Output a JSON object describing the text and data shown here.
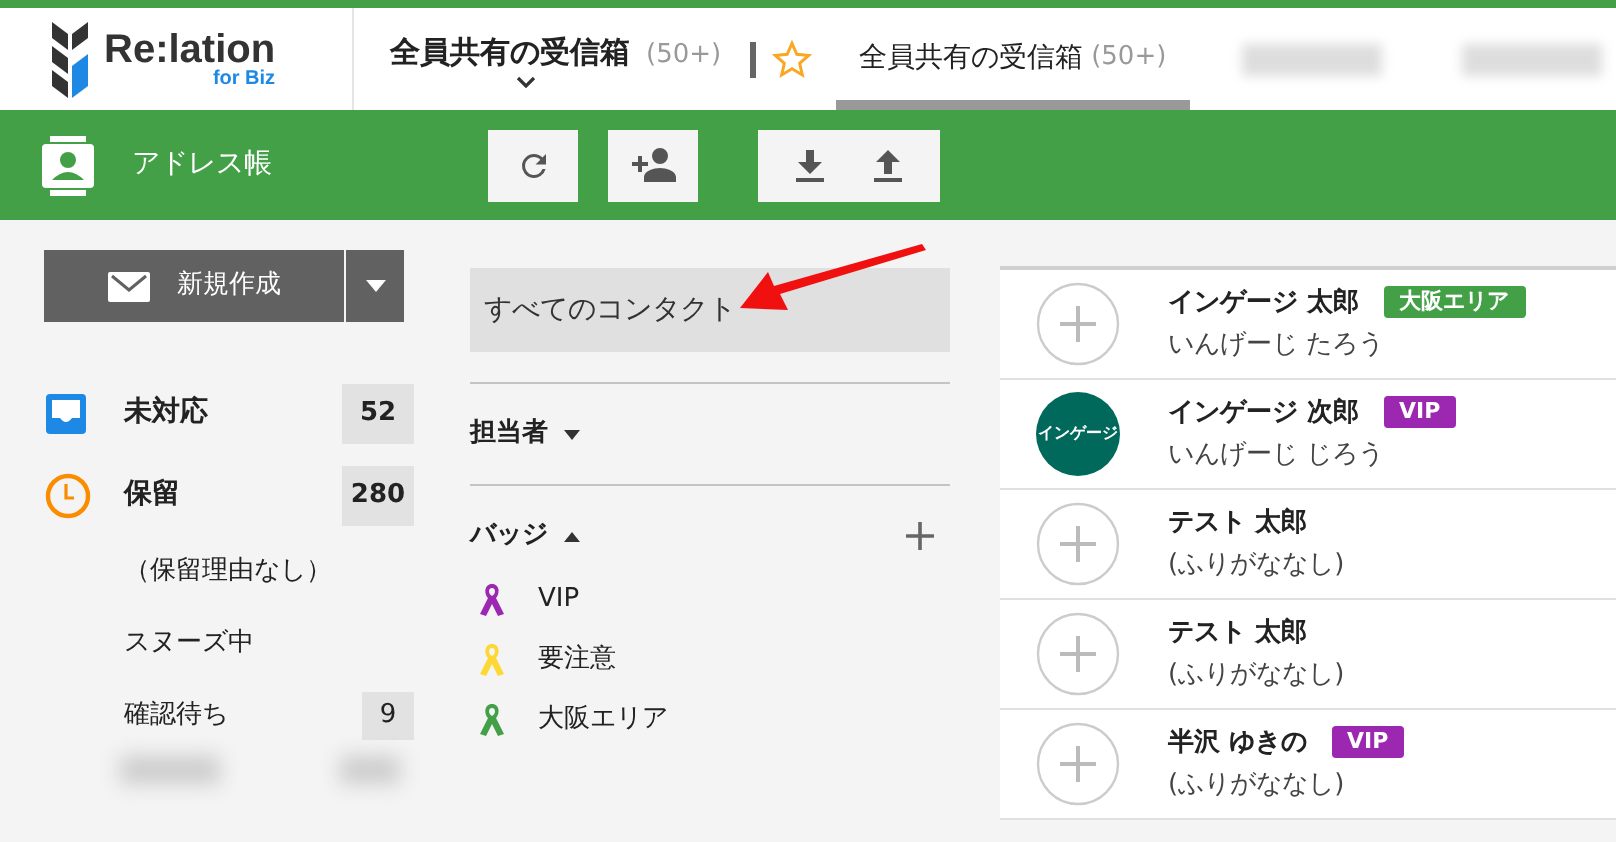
{
  "logo": {
    "name": "Re:lation",
    "sub": "for Biz"
  },
  "header_tabs": [
    {
      "kind": "dropdown",
      "label": "全員共有の受信箱",
      "count": "(50+)"
    },
    {
      "kind": "favorite",
      "label": "全員共有の受信箱",
      "count": "(50+)"
    }
  ],
  "toolbar": {
    "title": "アドレス帳"
  },
  "compose": {
    "label": "新規作成"
  },
  "sidebar": {
    "items": [
      {
        "kind": "inbox",
        "label": "未対応",
        "count": "52"
      },
      {
        "kind": "hold",
        "label": "保留",
        "count": "280",
        "children": [
          {
            "label": "（保留理由なし）"
          },
          {
            "label": "スヌーズ中"
          },
          {
            "label": "確認待ち",
            "count": "9"
          }
        ]
      }
    ]
  },
  "filters": {
    "all": "すべてのコンタクト",
    "assignee": "担当者",
    "badges_title": "バッジ",
    "badges": [
      {
        "label": "VIP",
        "color": "#9c27b0"
      },
      {
        "label": "要注意",
        "color": "#fdd835"
      },
      {
        "label": "大阪エリア",
        "color": "#43a047"
      }
    ]
  },
  "contacts": [
    {
      "kind": "empty",
      "name": "インゲージ 太郎",
      "kana": "いんげーじ たろう",
      "badge": {
        "label": "大阪エリア",
        "color": "#43a047"
      }
    },
    {
      "kind": "text",
      "avatar_text": "インゲージ",
      "name": "インゲージ 次郎",
      "kana": "いんげーじ じろう",
      "badge": {
        "label": "VIP",
        "color": "#9c27b0"
      }
    },
    {
      "kind": "empty",
      "name": "テスト 太郎",
      "kana": "(ふりがななし)"
    },
    {
      "kind": "empty",
      "name": "テスト 太郎",
      "kana": "(ふりがななし)"
    },
    {
      "kind": "empty",
      "name": "半沢 ゆきの",
      "kana": "(ふりがななし)",
      "badge": {
        "label": "VIP",
        "color": "#9c27b0"
      }
    }
  ]
}
